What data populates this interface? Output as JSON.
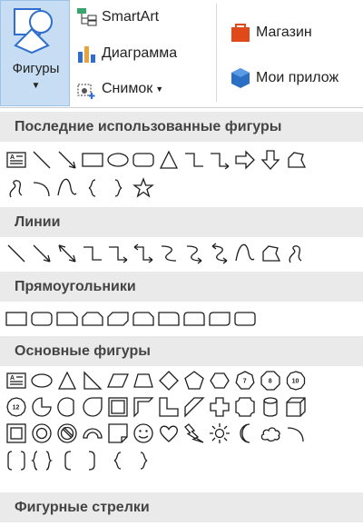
{
  "ribbon": {
    "shapes_label": "Фигуры",
    "smartart_label": "SmartArt",
    "chart_label": "Диаграмма",
    "screenshot_label": "Снимок",
    "store_label": "Магазин",
    "myapps_label": "Мои прилож"
  },
  "sections": {
    "recent": "Последние использованные фигуры",
    "lines": "Линии",
    "rectangles": "Прямоугольники",
    "basic": "Основные фигуры",
    "arrows": "Фигурные стрелки"
  },
  "numbered": {
    "heptagon": "7",
    "octagon": "8",
    "decagon": "10",
    "dodecagon": "12"
  },
  "colors": {
    "selected_bg": "#c6ddf3",
    "header_bg": "#eaeaea",
    "store_icon": "#e04a1b",
    "apps_icon": "#2b6fc4"
  }
}
